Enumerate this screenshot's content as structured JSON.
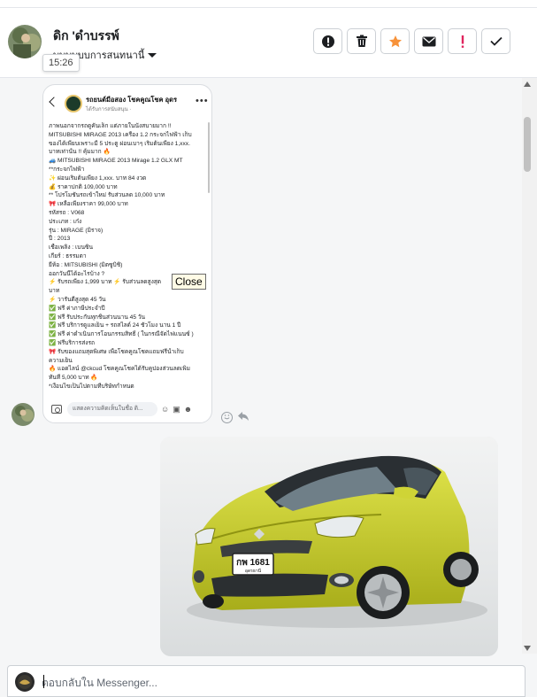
{
  "header": {
    "name": "ดิก 'ดำบรรพ์",
    "subtitle": "บบบบบบการสนทนานี้",
    "time_tooltip": "15:26"
  },
  "actions": [
    {
      "name": "report-icon",
      "symbol": "!"
    },
    {
      "name": "trash-icon",
      "symbol": ""
    },
    {
      "name": "star-icon",
      "symbol": "★"
    },
    {
      "name": "mail-icon",
      "symbol": ""
    },
    {
      "name": "priority-icon",
      "symbol": "!"
    },
    {
      "name": "check-icon",
      "symbol": "✓"
    }
  ],
  "post": {
    "page_name": "รถยนต์มือสอง โชคคูณโชค อุดร",
    "page_meta": "ได้รับการสนับสนุน · ",
    "lines": [
      "ภาพนอกจากรถดูคันเล็ก แต่ภายในนั่งสบายมาก !!",
      "MITSUBISHI MIRAGE 2013 เครื่อง 1.2 กระจกไฟฟ้า เก็บ",
      "ของได้เพียบเพราะมี 5 ประตู ผ่อนเบาๆ เริ่มต้นเพียง 1,xxx.",
      "บาทเท่านั้น !! คุ้มมาก 🔥",
      "🚙 MITSUBISHI MIRAGE 2013 Mirage 1.2 GLX MT",
      "**กระจกไฟฟ้า",
      "✨ ผ่อนเริ่มต้นเพียง 1,xxx. บาท 84 งวด",
      "💰 ราคาปกติ 109,000 บาท",
      "** โปรโมชั่นรถเข้าใหม่ รับส่วนลด 10,000 บาท",
      "🎀 เหลือเพียงราคา 99,000 บาท",
      "  รหัสรถ : V068",
      "  ประเภท : เก๋ง",
      "  รุ่น : MIRAGE (มิราจ)",
      "  ปี : 2013",
      "  เชื้อเพลิง : เบนซิน",
      "  เกียร์ : ธรรมดา",
      "  ยี่ห้อ : MITSUBISHI (มิตซูบิชิ)",
      "ออกวันนี้ได้อะไรบ้าง ?",
      "⚡ รับรถเพียง 1,999 บาท ⚡ รับส่วนลดสูงสุด",
      "บาท",
      "⚡ วารันตีสูงสุด 45 วัน",
      "✅ ฟรี ค่าภาษีประจำปี",
      "✅ ฟรี รับประกันทุกชิ้นส่วนนาน 45 วัน",
      "✅ ฟรี บริการดูแลเย็น + รถสไลด์ 24 ชั่วโมง นาน 1 ปี",
      "✅ ฟรี ค่าดำเนินการโอนกรรมสิทธิ์ ( ในกรณีจัดไฟแนนซ์ )",
      "✅ ฟรีบริการส่งรถ",
      "🎀 รับของแถมสุดพิเศษ เพื่อโชคคูณโชคแถมฟรีน้ำเก็บ",
      "ความเย็น",
      "🔥 แอดไลน์ @ckcud โชคคูณโชคได้รับคูปองส่วนลดเพิ่ม",
      "ทันที 5,000 บาท 🔥",
      "*เงื่อนไขเป็นไปตามที่บริษัทกำหนด"
    ],
    "comment_placeholder": "แสดงความคิดเห็นในชื่อ ดิ...",
    "close_tooltip": "Close"
  },
  "photo": {
    "plate_line1": "กพ 1681",
    "plate_line2": "อุดรธานี"
  },
  "composer": {
    "placeholder": "ตอบกลับใน Messenger..."
  },
  "colors": {
    "accent_orange": "#f7923a",
    "priority_red": "#e0245e",
    "car_yellow": "#c9cf2a"
  }
}
